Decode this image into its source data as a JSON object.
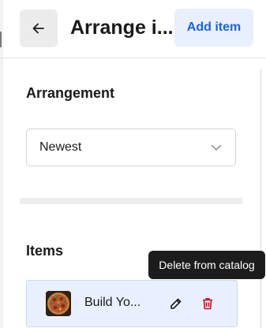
{
  "header": {
    "title": "Arrange i...",
    "back_icon": "arrow-left-icon",
    "add_button_label": "Add item",
    "accent_color": "#1b64e8"
  },
  "arrangement": {
    "heading": "Arrangement",
    "selected": "Newest",
    "dropdown_icon": "chevron-down-icon"
  },
  "items": {
    "heading": "Items",
    "rows": [
      {
        "name": "Build Yo...",
        "thumbnail": "pizza-thumbnail",
        "edit_icon": "pencil-icon",
        "delete_icon": "trash-icon",
        "delete_color": "#c0142b"
      }
    ]
  },
  "tooltip": {
    "text": "Delete from catalog"
  }
}
